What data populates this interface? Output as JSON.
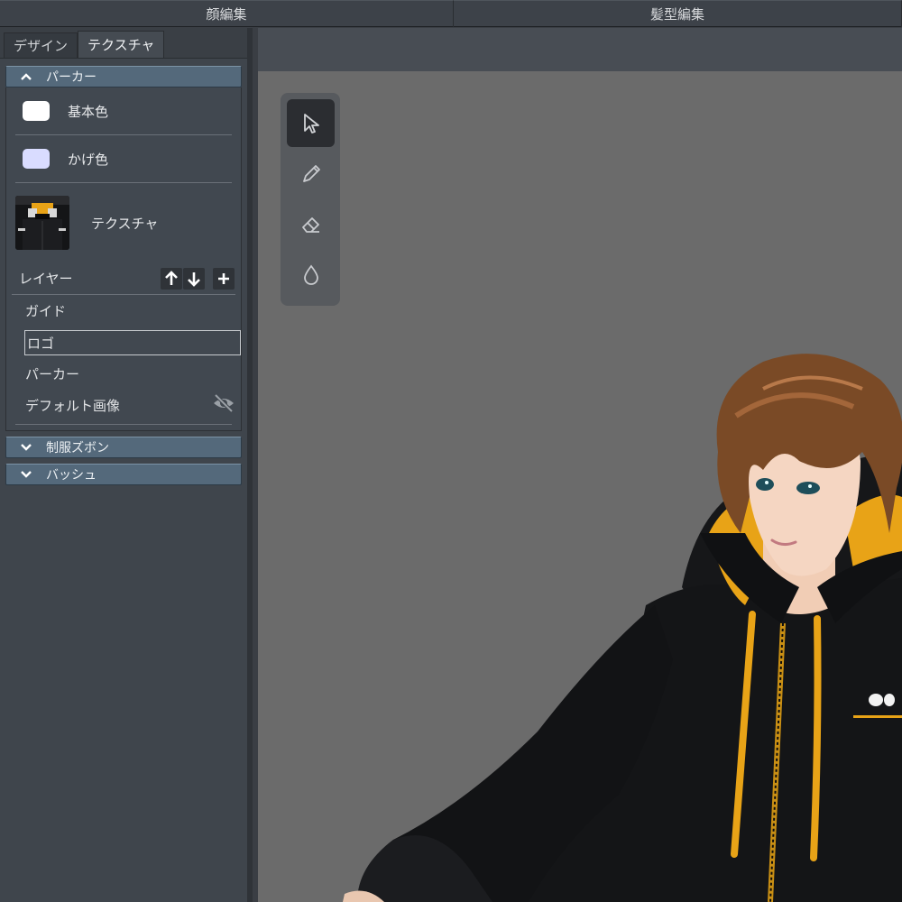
{
  "top_tabs": [
    "顔編集",
    "髪型編集"
  ],
  "sub_tabs": [
    "デザイン",
    "テクスチャ"
  ],
  "sections": {
    "hoodie": {
      "title": "パーカー",
      "expanded": true,
      "base_color_label": "基本色",
      "base_color": "#ffffff",
      "shade_color_label": "かげ色",
      "shade_color": "#d9dcff",
      "texture_label": "テクスチャ",
      "layer_label": "レイヤー",
      "layers": [
        "ガイド",
        "ロゴ",
        "パーカー",
        "デフォルト画像"
      ],
      "selected_layer": "ロゴ"
    },
    "pants": {
      "title": "制服ズボン",
      "expanded": false
    },
    "badge": {
      "title": "バッシュ",
      "expanded": false
    }
  },
  "tools": [
    "select-tool",
    "pencil-tool",
    "eraser-tool",
    "fill-tool"
  ],
  "active_tool": "select-tool",
  "colors": {
    "accent_section": "#54697b",
    "viewport_bg": "#6b6b6b",
    "hoodie_black": "#141517",
    "hoodie_yellow": "#e8a317"
  }
}
